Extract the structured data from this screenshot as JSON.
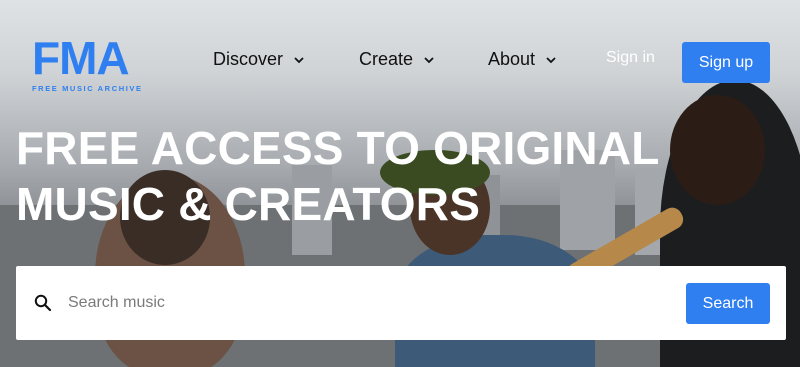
{
  "logo": {
    "mark": "FMA",
    "subtitle": "FREE MUSIC ARCHIVE"
  },
  "nav": {
    "items": [
      {
        "label": "Discover",
        "icon": "chevron-down-icon"
      },
      {
        "label": "Create",
        "icon": "chevron-down-icon"
      },
      {
        "label": "About",
        "icon": "chevron-down-icon"
      }
    ],
    "sign_in": "Sign in",
    "sign_up": "Sign up"
  },
  "hero": {
    "headline": "FREE ACCESS TO ORIGINAL MUSIC & CREATORS"
  },
  "search": {
    "placeholder": "Search music",
    "value": "",
    "button_label": "Search",
    "icon": "search-icon"
  },
  "colors": {
    "accent": "#2f7ff0",
    "headline": "#ffffff",
    "nav_text": "#111111"
  }
}
